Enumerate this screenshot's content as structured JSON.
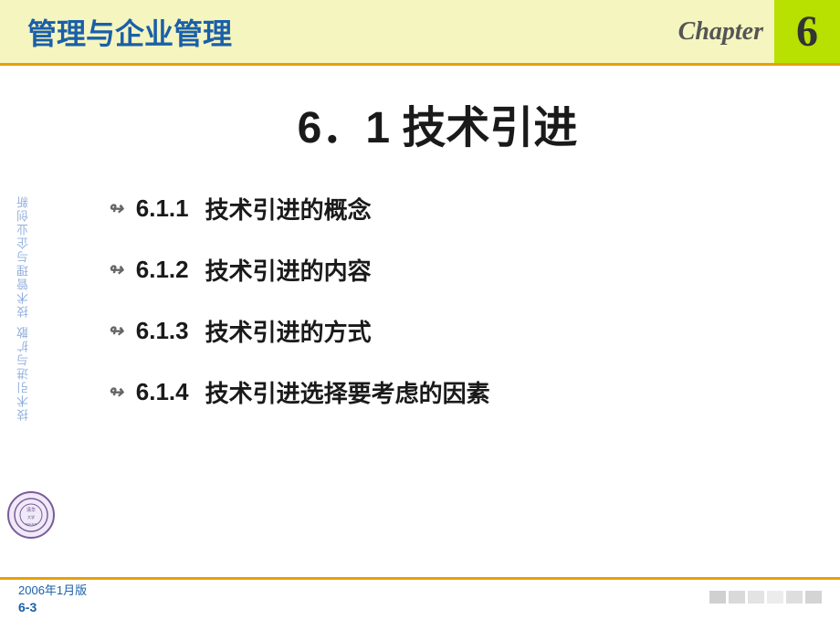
{
  "header": {
    "title": "管理与企业管理",
    "chapter_label": "Chapter",
    "chapter_number": "6"
  },
  "sidebar": {
    "watermark1": "技术管理与企业创新",
    "watermark2": "技术引进与扩散"
  },
  "main": {
    "section_title": "6．1  技术引进",
    "menu_items": [
      {
        "number": "6.1.1",
        "title": "技术引进的概念"
      },
      {
        "number": "6.1.2",
        "title": "技术引进的内容"
      },
      {
        "number": "6.1.3",
        "title": "技术引进的方式"
      },
      {
        "number": "6.1.4",
        "title": "技术引进选择要考虑的因素"
      }
    ],
    "menu_icon": "↬"
  },
  "footer": {
    "date": "2006年1月版",
    "page": "6-3"
  }
}
